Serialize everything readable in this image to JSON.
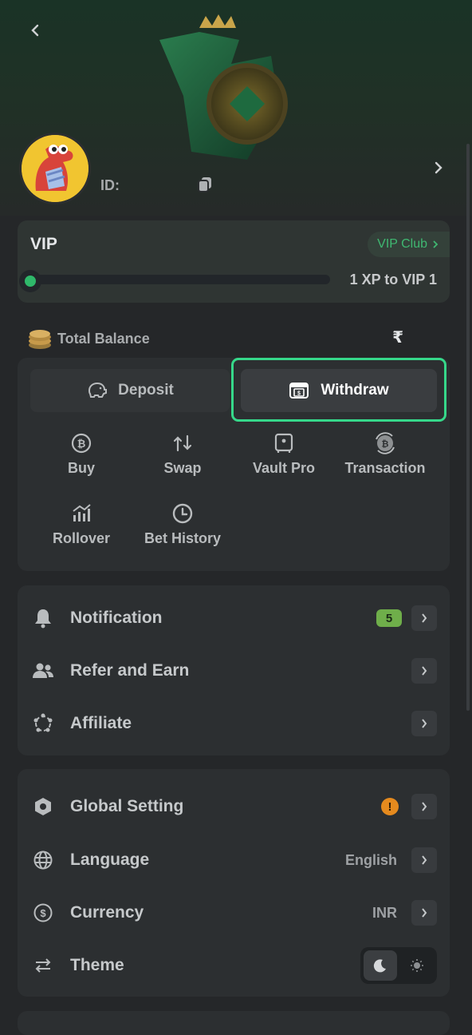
{
  "profile": {
    "id_label": "ID:"
  },
  "vip": {
    "title": "VIP",
    "club_label": "VIP Club",
    "xp_text": "1 XP to VIP 1",
    "progress_percent": 0
  },
  "balance": {
    "label": "Total Balance",
    "currency_symbol": "₹"
  },
  "wallet": {
    "deposit_label": "Deposit",
    "withdraw_label": "Withdraw",
    "actions": [
      {
        "label": "Buy",
        "icon": "bitcoin-coin-icon"
      },
      {
        "label": "Swap",
        "icon": "swap-arrows-icon"
      },
      {
        "label": "Vault Pro",
        "icon": "vault-icon"
      },
      {
        "label": "Transaction",
        "icon": "transaction-icon"
      },
      {
        "label": "Rollover",
        "icon": "rollover-chart-icon"
      },
      {
        "label": "Bet History",
        "icon": "clock-icon"
      }
    ]
  },
  "menu": {
    "items": [
      {
        "label": "Notification",
        "badge": "5",
        "icon": "bell-icon"
      },
      {
        "label": "Refer and Earn",
        "icon": "users-icon"
      },
      {
        "label": "Affiliate",
        "icon": "affiliate-icon"
      }
    ]
  },
  "settings": {
    "items": [
      {
        "label": "Global Setting",
        "status": "!",
        "icon": "hexagon-gear-icon"
      },
      {
        "label": "Language",
        "value": "English",
        "icon": "globe-icon"
      },
      {
        "label": "Currency",
        "value": "INR",
        "icon": "dollar-circle-icon"
      },
      {
        "label": "Theme",
        "icon": "theme-arrows-icon"
      }
    ]
  },
  "colors": {
    "accent_green": "#2fb86a",
    "highlight_outline": "#36d88a",
    "badge_green": "#6fae4a",
    "warning_orange": "#e58a1e"
  }
}
